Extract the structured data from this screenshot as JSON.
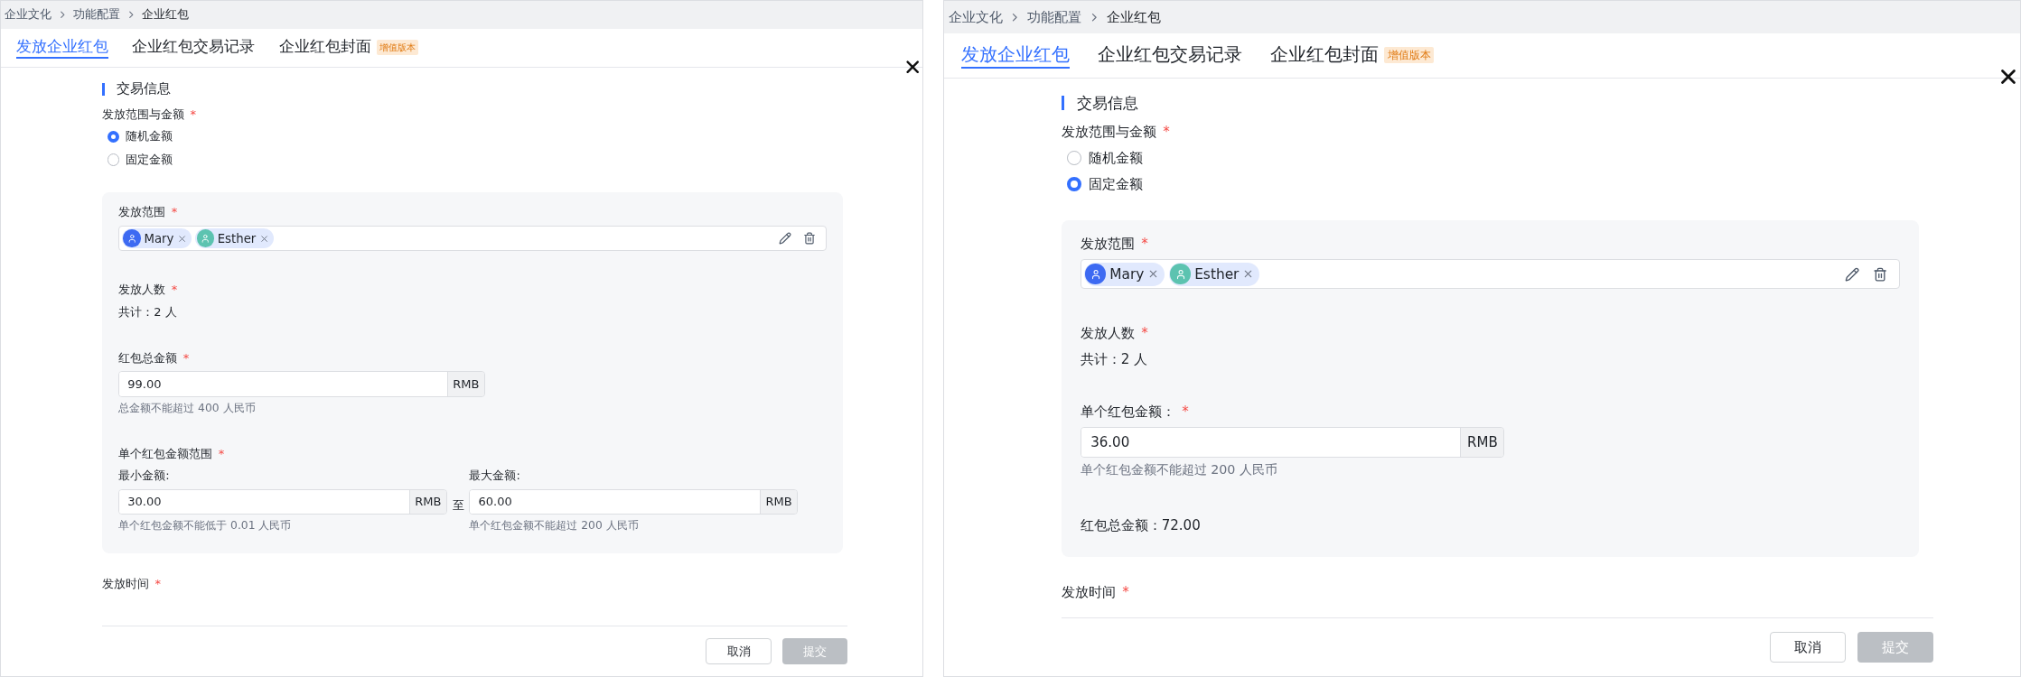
{
  "panels": [
    {
      "breadcrumb": [
        "企业文化",
        "功能配置",
        "企业红包"
      ],
      "tabs": [
        {
          "label": "发放企业红包",
          "selected": true
        },
        {
          "label": "企业红包交易记录",
          "selected": false
        },
        {
          "label": "企业红包封面",
          "selected": false,
          "badge": "增值版本"
        }
      ],
      "section_title": "交易信息",
      "scope_amount": {
        "label": "发放范围与金额",
        "mark": "*",
        "options": [
          {
            "label": "随机金额",
            "selected": true
          },
          {
            "label": "固定金额",
            "selected": false
          }
        ]
      },
      "card": {
        "fields": [
          {
            "kind": "recipients",
            "label": "发放范围",
            "mark": "*",
            "tags": [
              {
                "name": "Mary",
                "color": "#3d6af2"
              },
              {
                "name": "Esther",
                "color": "#5cc3b0"
              }
            ]
          },
          {
            "kind": "count",
            "label": "发放人数",
            "mark": "*",
            "value": "共计：2 人"
          },
          {
            "kind": "amount",
            "label": "红包总金额",
            "mark": "*",
            "value": "99.00",
            "unit": "RMB",
            "hint": "总金额不能超过 400 人民币"
          },
          {
            "kind": "range",
            "label": "单个红包金额范围",
            "mark": "*",
            "separator": "至",
            "min": {
              "label": "最小金额:",
              "value": "30.00",
              "unit": "RMB",
              "hint": "单个红包金额不能低于 0.01 人民币"
            },
            "max": {
              "label": "最大金额:",
              "value": "60.00",
              "unit": "RMB",
              "hint": "单个红包金额不能超过 200 人民币"
            }
          }
        ]
      },
      "send_time": {
        "label": "发放时间",
        "mark": "*"
      },
      "buttons": [
        {
          "label": "取消",
          "kind": "secondary",
          "disabled": false
        },
        {
          "label": "提交",
          "kind": "primary",
          "disabled": true
        }
      ]
    },
    {
      "breadcrumb": [
        "企业文化",
        "功能配置",
        "企业红包"
      ],
      "tabs": [
        {
          "label": "发放企业红包",
          "selected": true
        },
        {
          "label": "企业红包交易记录",
          "selected": false
        },
        {
          "label": "企业红包封面",
          "selected": false,
          "badge": "增值版本"
        }
      ],
      "section_title": "交易信息",
      "scope_amount": {
        "label": "发放范围与金额",
        "mark": "*",
        "options": [
          {
            "label": "随机金额",
            "selected": false
          },
          {
            "label": "固定金额",
            "selected": true
          }
        ]
      },
      "card": {
        "fields": [
          {
            "kind": "recipients",
            "label": "发放范围",
            "mark": "*",
            "tags": [
              {
                "name": "Mary",
                "color": "#3d6af2"
              },
              {
                "name": "Esther",
                "color": "#5cc3b0"
              }
            ]
          },
          {
            "kind": "count",
            "label": "发放人数",
            "mark": "*",
            "value": "共计：2 人"
          },
          {
            "kind": "amount",
            "label": "单个红包金额：",
            "mark": "*",
            "value": "36.00",
            "unit": "RMB",
            "hint": "单个红包金额不能超过 200 人民币"
          },
          {
            "kind": "total",
            "value": "红包总金额：72.00"
          }
        ]
      },
      "send_time": {
        "label": "发放时间",
        "mark": "*"
      },
      "buttons": [
        {
          "label": "取消",
          "kind": "secondary",
          "disabled": false
        },
        {
          "label": "提交",
          "kind": "primary",
          "disabled": true
        }
      ]
    }
  ]
}
